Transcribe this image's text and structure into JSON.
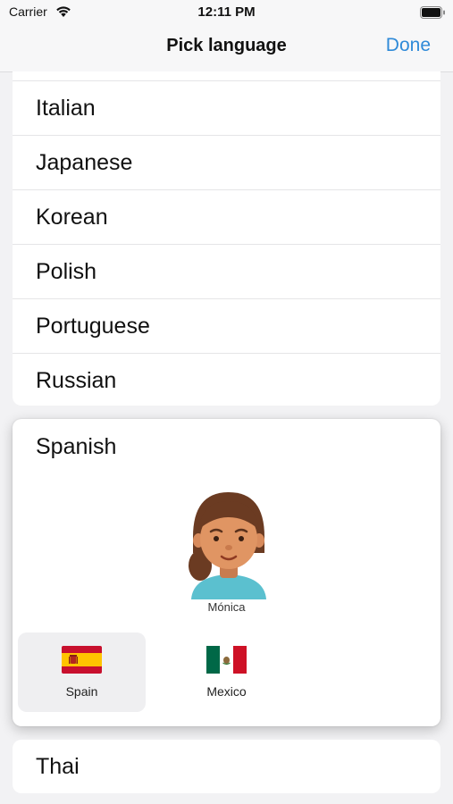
{
  "status_bar": {
    "carrier": "Carrier",
    "time": "12:11 PM",
    "wifi_icon": "wifi-icon",
    "battery_icon": "battery-icon"
  },
  "nav": {
    "title": "Pick language",
    "done_label": "Done",
    "accent_color": "#2f8ad8"
  },
  "languages_above": [
    {
      "label": "Italian"
    },
    {
      "label": "Japanese"
    },
    {
      "label": "Korean"
    },
    {
      "label": "Polish"
    },
    {
      "label": "Portuguese"
    },
    {
      "label": "Russian"
    }
  ],
  "expanded": {
    "language": "Spanish",
    "voice": {
      "name": "Mónica",
      "icon": "avatar-icon"
    },
    "regions": [
      {
        "label": "Spain",
        "flag": "spain-flag-icon",
        "selected": true
      },
      {
        "label": "Mexico",
        "flag": "mexico-flag-icon",
        "selected": false
      }
    ]
  },
  "languages_below": [
    {
      "label": "Thai"
    }
  ]
}
